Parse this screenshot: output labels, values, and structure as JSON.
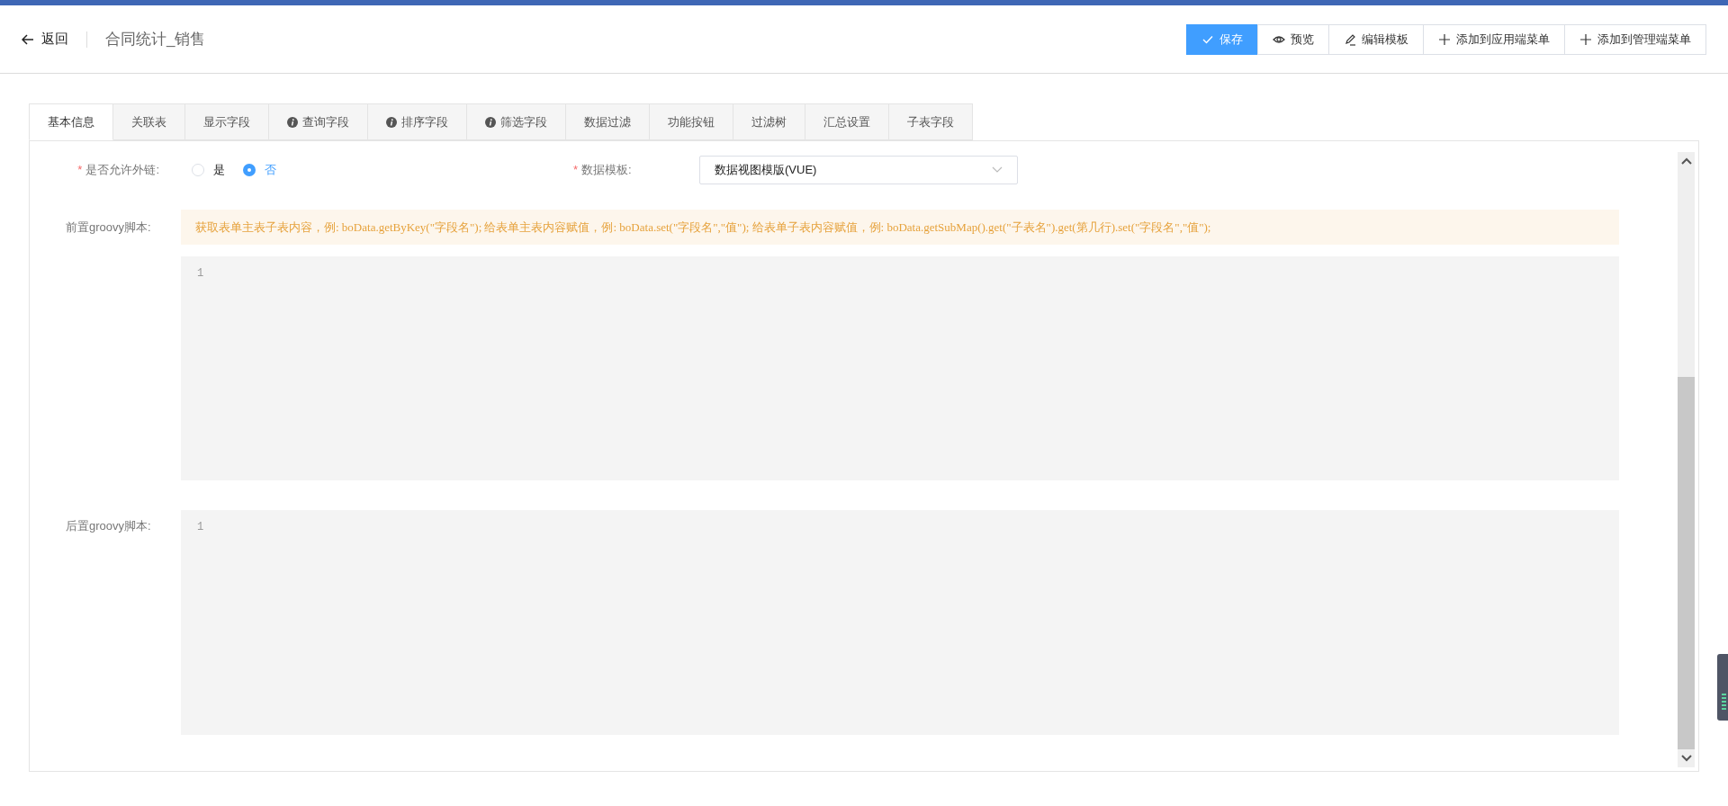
{
  "header": {
    "back": "返回",
    "title": "合同统计_销售"
  },
  "toolbar": [
    {
      "label": "保存",
      "kind": "check",
      "primary": true
    },
    {
      "label": "预览",
      "kind": "eye",
      "primary": false
    },
    {
      "label": "编辑模板",
      "kind": "pen",
      "primary": false
    },
    {
      "label": "添加到应用端菜单",
      "kind": "plus",
      "primary": false
    },
    {
      "label": "添加到管理端菜单",
      "kind": "plus",
      "primary": false
    }
  ],
  "tabs": [
    {
      "label": "基本信息",
      "selected": true,
      "info": false
    },
    {
      "label": "关联表",
      "selected": false,
      "info": false
    },
    {
      "label": "显示字段",
      "selected": false,
      "info": false
    },
    {
      "label": "查询字段",
      "selected": false,
      "info": true
    },
    {
      "label": "排序字段",
      "selected": false,
      "info": true
    },
    {
      "label": "筛选字段",
      "selected": false,
      "info": true
    },
    {
      "label": "数据过滤",
      "selected": false,
      "info": false
    },
    {
      "label": "功能按钮",
      "selected": false,
      "info": false
    },
    {
      "label": "过滤树",
      "selected": false,
      "info": false
    },
    {
      "label": "汇总设置",
      "selected": false,
      "info": false
    },
    {
      "label": "子表字段",
      "selected": false,
      "info": false
    }
  ],
  "form": {
    "external_link": {
      "required_mark": "*",
      "label": "是否允许外链:",
      "options": [
        {
          "label": "是",
          "selected": false
        },
        {
          "label": "否",
          "selected": true
        }
      ]
    },
    "template": {
      "required_mark": "*",
      "label": "数据模板:",
      "value": "数据视图模版(VUE)"
    },
    "pre_script": {
      "label": "前置groovy脚本:",
      "hint": "获取表单主表子表内容，例: boData.getByKey(\"字段名\"); 给表单主表内容赋值，例: boData.set(\"字段名\",\"值\"); 给表单子表内容赋值，例: boData.getSubMap().get(\"子表名\").get(第几行).set(\"字段名\",\"值\");",
      "line_numbers": [
        "1"
      ]
    },
    "post_script": {
      "label": "后置groovy脚本:",
      "line_numbers": [
        "1"
      ]
    }
  }
}
